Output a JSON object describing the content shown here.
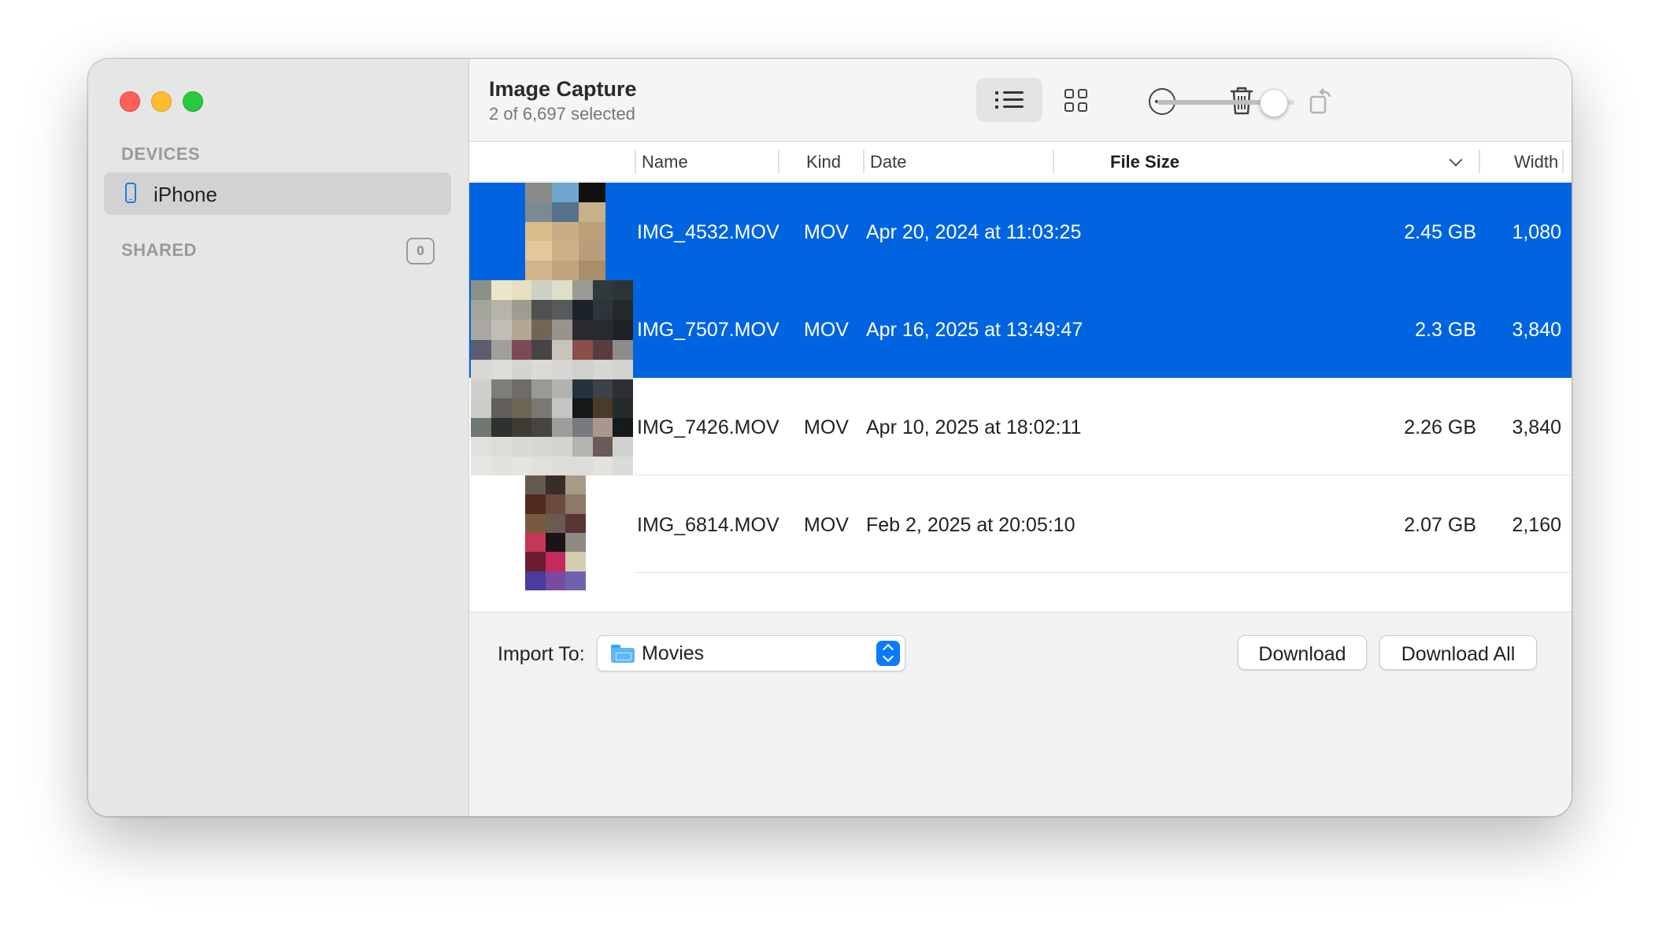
{
  "window": {
    "title": "Image Capture",
    "subtitle": "2 of 6,697 selected"
  },
  "sidebar": {
    "devices_header": "DEVICES",
    "devices": [
      {
        "label": "iPhone",
        "icon": "iphone-icon",
        "selected": true
      }
    ],
    "shared_header": "SHARED",
    "shared_count": "0"
  },
  "toolbar": {
    "buttons": [
      "list-view-icon",
      "grid-view-icon",
      "more-icon",
      "trash-icon",
      "rotate-icon"
    ],
    "thumbnail_size_slider": 0.85
  },
  "table": {
    "columns": [
      "Name",
      "Kind",
      "Date",
      "File Size",
      "Width"
    ],
    "sort_column": "File Size",
    "sort_direction": "descending",
    "rows": [
      {
        "name": "IMG_4532.MOV",
        "kind": "MOV",
        "date": "Apr 20, 2024 at 11:03:25",
        "size": "2.45 GB",
        "width": "1,080",
        "selected": true
      },
      {
        "name": "IMG_7507.MOV",
        "kind": "MOV",
        "date": "Apr 16, 2025 at 13:49:47",
        "size": "2.3 GB",
        "width": "3,840",
        "selected": true
      },
      {
        "name": "IMG_7426.MOV",
        "kind": "MOV",
        "date": "Apr 10, 2025 at 18:02:11",
        "size": "2.26 GB",
        "width": "3,840",
        "selected": false
      },
      {
        "name": "IMG_6814.MOV",
        "kind": "MOV",
        "date": "Feb 2, 2025 at 20:05:10",
        "size": "2.07 GB",
        "width": "2,160",
        "selected": false
      }
    ]
  },
  "footer": {
    "import_label": "Import To:",
    "import_destination": "Movies",
    "download_label": "Download",
    "download_all_label": "Download All"
  },
  "colors": {
    "selection": "#0064e0",
    "accent": "#0a7aff"
  }
}
